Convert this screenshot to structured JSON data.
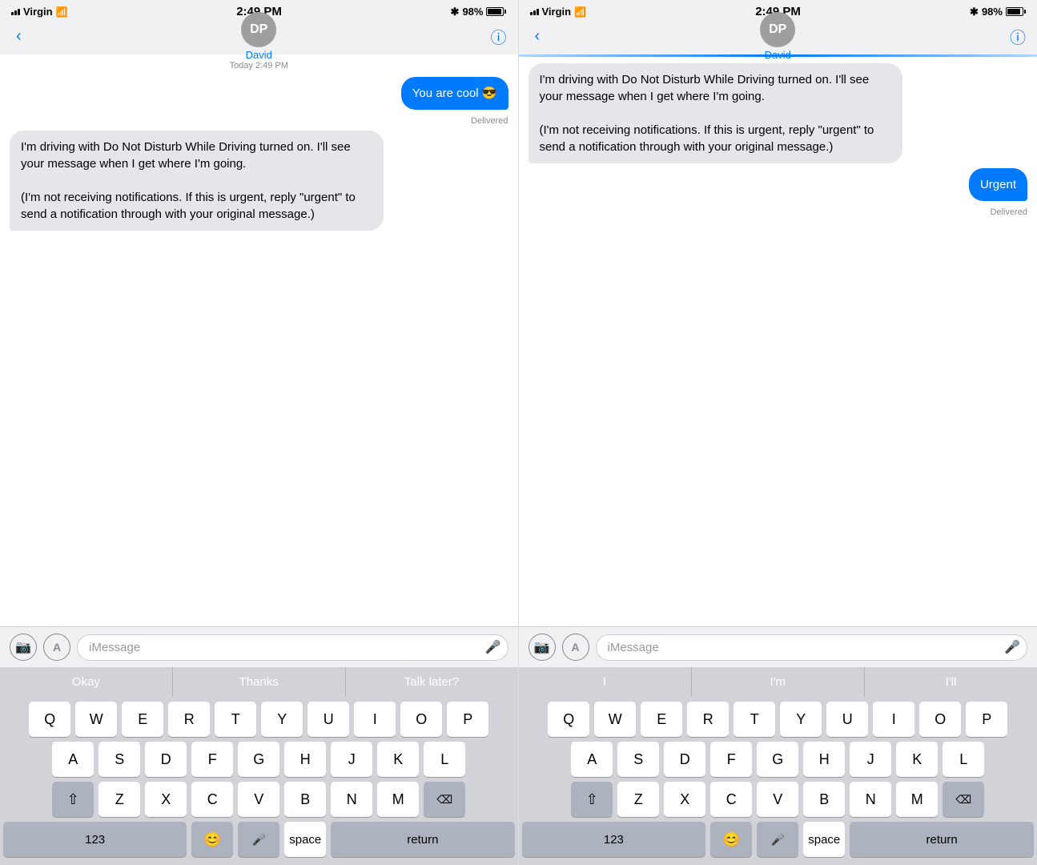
{
  "left": {
    "status": {
      "carrier": "Virgin",
      "time": "2:49 PM",
      "battery": "98%"
    },
    "contact": "David",
    "initials": "DP",
    "timestamp_label": "Today 2:49 PM",
    "messages": [
      {
        "type": "outgoing",
        "text": "You are cool 😎",
        "delivered": true
      },
      {
        "type": "incoming",
        "text": "I'm driving with Do Not Disturb While Driving turned on. I'll see your message when I get where I'm going.\n\n(I'm not receiving notifications. If this is urgent, reply \"urgent\" to send a notification through with your original message.)"
      }
    ],
    "input_placeholder": "iMessage",
    "predictive": [
      "Okay",
      "Thanks",
      "Talk later?"
    ],
    "keyboard_rows": [
      [
        "Q",
        "W",
        "E",
        "R",
        "T",
        "Y",
        "U",
        "I",
        "O",
        "P"
      ],
      [
        "A",
        "S",
        "D",
        "F",
        "G",
        "H",
        "J",
        "K",
        "L"
      ],
      [
        "⇧",
        "Z",
        "X",
        "C",
        "V",
        "B",
        "N",
        "M",
        "⌫"
      ],
      [
        "123",
        "😊",
        "🎤",
        "space",
        "return"
      ]
    ]
  },
  "right": {
    "status": {
      "carrier": "Virgin",
      "time": "2:49 PM",
      "battery": "98%"
    },
    "contact": "David",
    "initials": "DP",
    "messages": [
      {
        "type": "incoming",
        "text": "I'm driving with Do Not Disturb While Driving turned on. I'll see your message when I get where I'm going.\n\n(I'm not receiving notifications. If this is urgent, reply \"urgent\" to send a notification through with your original message.)"
      },
      {
        "type": "outgoing",
        "text": "Urgent",
        "delivered": true
      }
    ],
    "input_placeholder": "iMessage",
    "predictive": [
      "I",
      "I'm",
      "I'll"
    ],
    "keyboard_rows": [
      [
        "Q",
        "W",
        "E",
        "R",
        "T",
        "Y",
        "U",
        "I",
        "O",
        "P"
      ],
      [
        "A",
        "S",
        "D",
        "F",
        "G",
        "H",
        "J",
        "K",
        "L"
      ],
      [
        "⇧",
        "Z",
        "X",
        "C",
        "V",
        "B",
        "N",
        "M",
        "⌫"
      ],
      [
        "123",
        "😊",
        "🎤",
        "space",
        "return"
      ]
    ]
  }
}
